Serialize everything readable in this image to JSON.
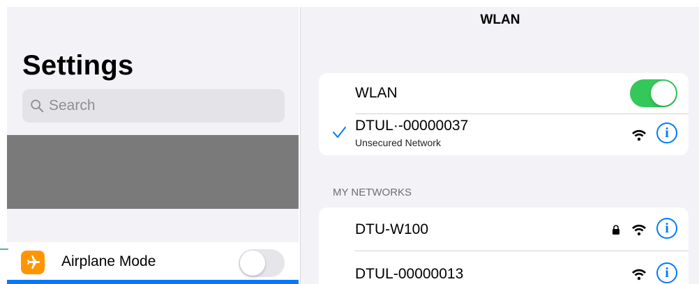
{
  "sidebar": {
    "title": "Settings",
    "search": {
      "placeholder": "Search"
    },
    "items": [
      {
        "label": "Airplane Mode",
        "icon": "airplane-icon",
        "toggle": false
      }
    ]
  },
  "wlan_page": {
    "nav_title": "WLAN",
    "wlan_toggle": {
      "label": "WLAN",
      "on": true
    },
    "connected": {
      "name": "DTUL·-00000037",
      "status": "Unsecured Network",
      "icons": [
        "checkmark-icon",
        "wifi-icon",
        "info-icon"
      ]
    },
    "my_networks": {
      "header": "MY NETWORKS",
      "items": [
        {
          "name": "DTU-W100",
          "secured": true
        },
        {
          "name": "DTUL-00000013",
          "secured": false
        }
      ]
    },
    "info_glyph": "i"
  },
  "colors": {
    "accent": "#007aff",
    "toggle_on": "#34c759",
    "airplane_icon_bg": "#ff9500",
    "redaction_block": "#7a7a7a"
  }
}
